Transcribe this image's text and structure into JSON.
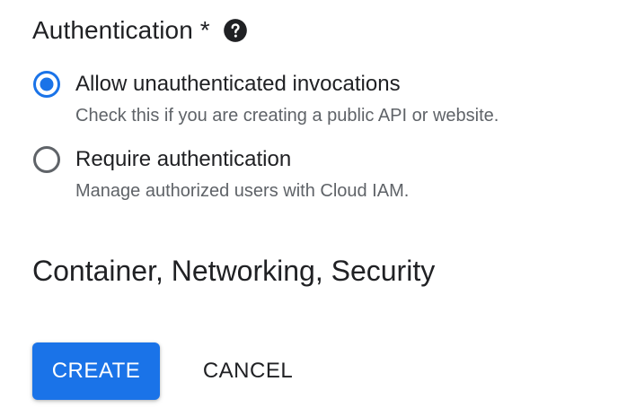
{
  "authentication": {
    "title": "Authentication *",
    "help_icon": "help-circle-icon",
    "options": [
      {
        "label": "Allow unauthenticated invocations",
        "description": "Check this if you are creating a public API or website.",
        "selected": true
      },
      {
        "label": "Require authentication",
        "description": "Manage authorized users with Cloud IAM.",
        "selected": false
      }
    ]
  },
  "section": {
    "title": "Container, Networking, Security"
  },
  "actions": {
    "create_label": "CREATE",
    "cancel_label": "CANCEL"
  },
  "colors": {
    "primary": "#1a73e8",
    "text": "#202124",
    "secondary_text": "#5f6368",
    "radio_unselected": "#5f6368"
  }
}
